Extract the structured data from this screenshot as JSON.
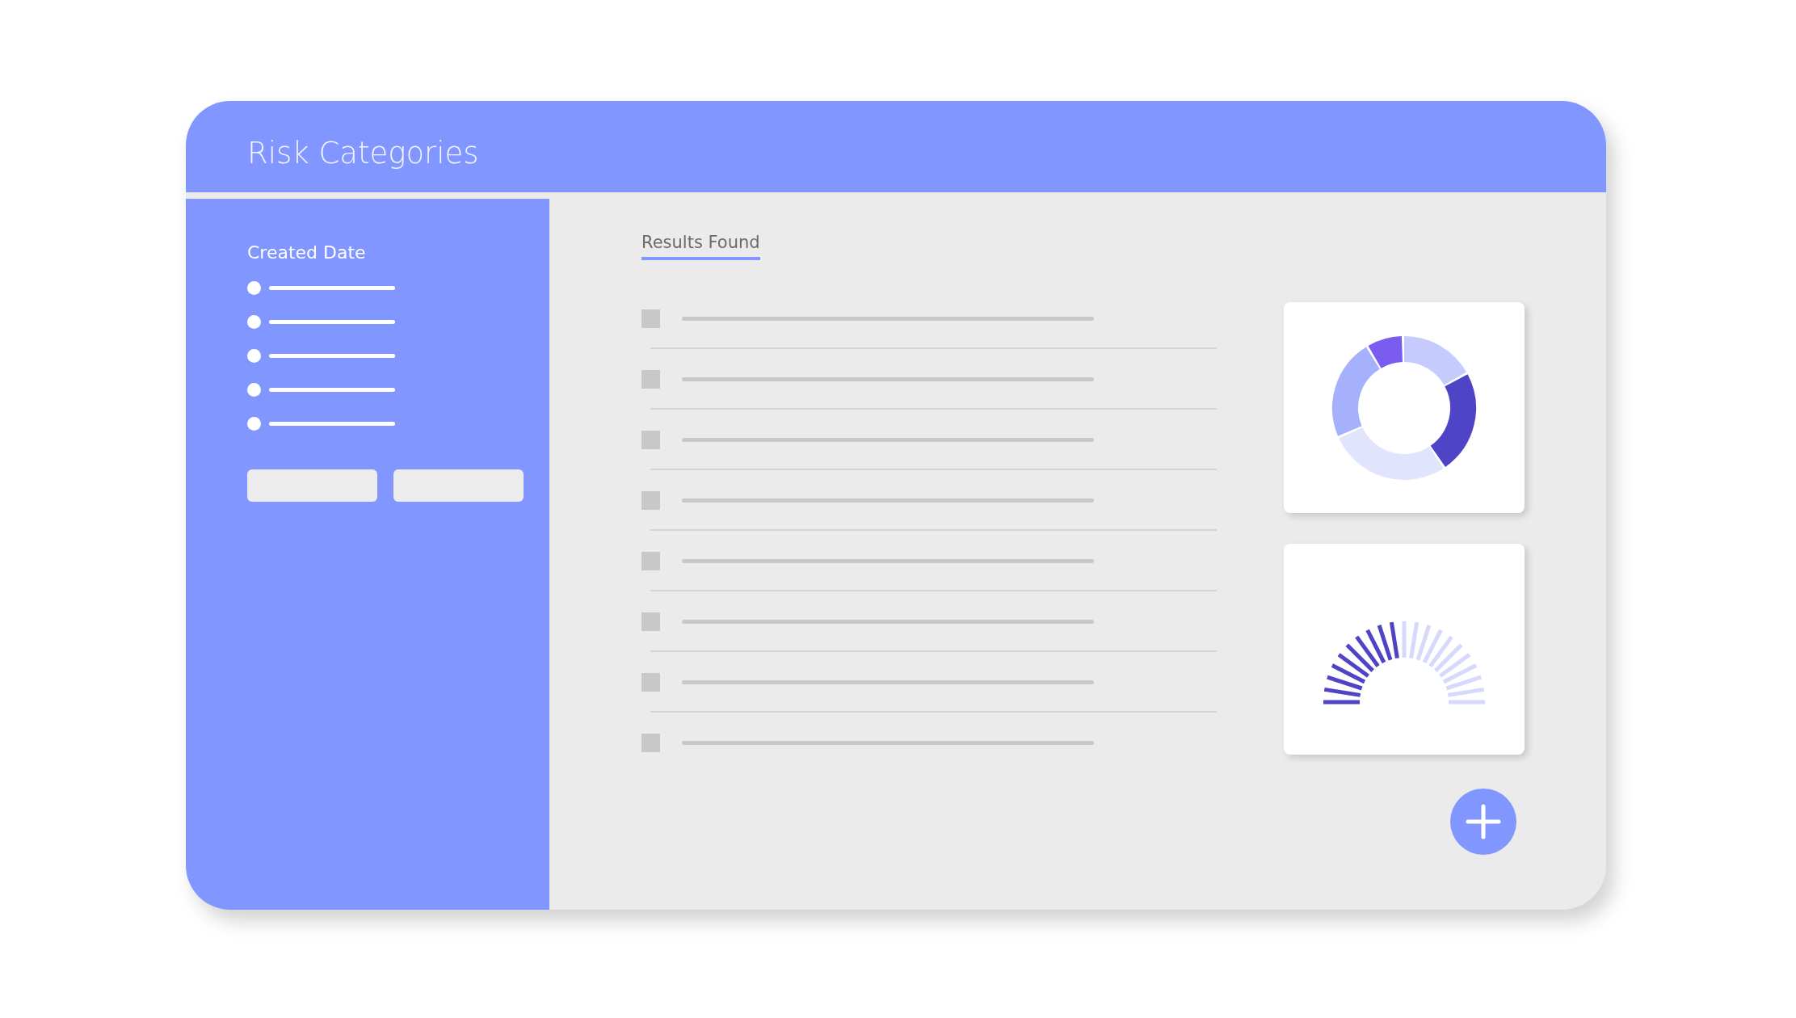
{
  "header": {
    "title": "Risk Categories"
  },
  "sidebar": {
    "heading": "Created Date"
  },
  "tabs": [
    {
      "label": "Results Found",
      "selected": true
    }
  ],
  "results": [
    {
      "checked": false
    },
    {
      "checked": false
    },
    {
      "checked": false
    },
    {
      "checked": false
    },
    {
      "checked": false
    },
    {
      "checked": false
    },
    {
      "checked": false
    },
    {
      "checked": false
    }
  ]
}
